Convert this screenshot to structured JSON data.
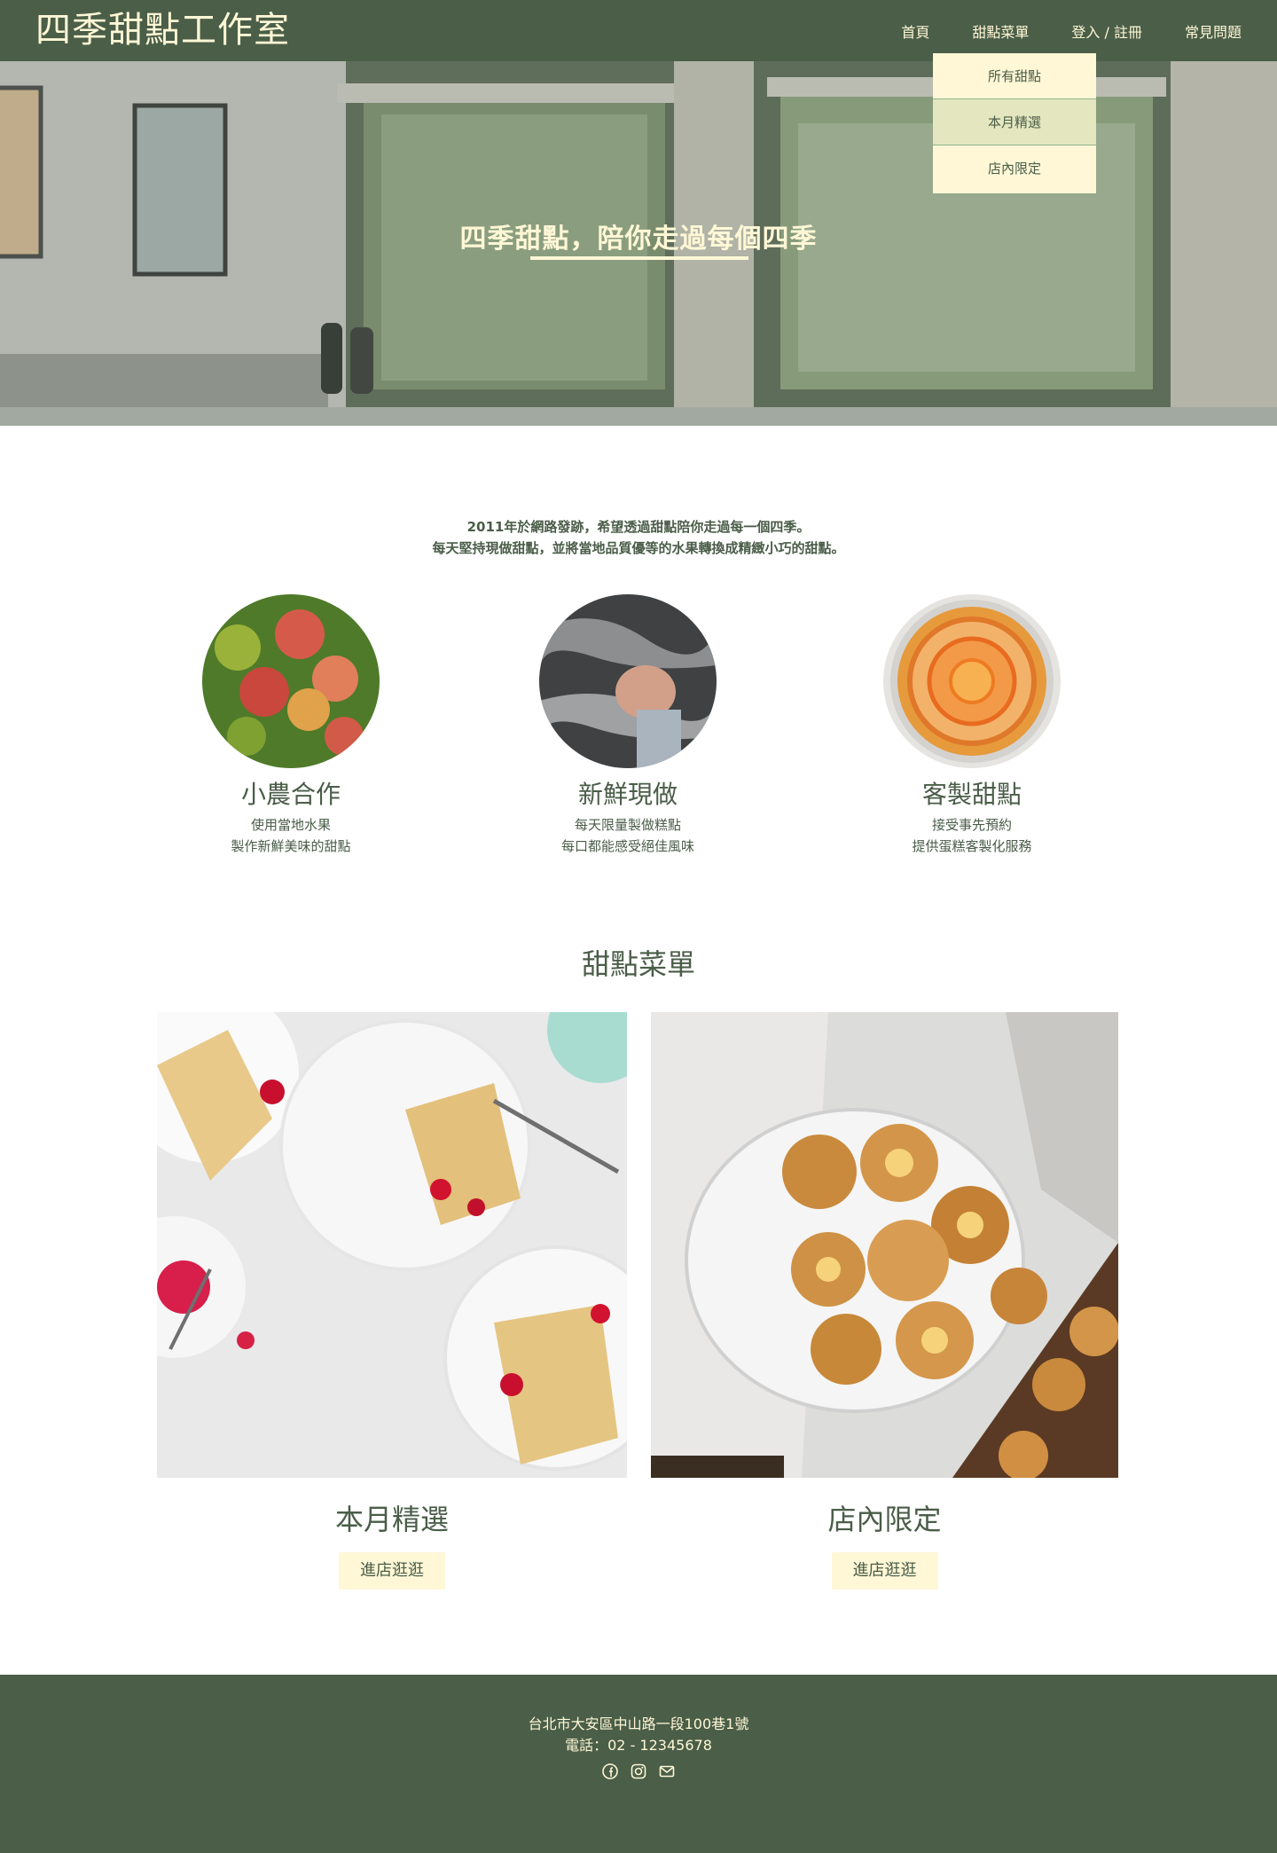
{
  "nav": {
    "brand": "四季甜點工作室",
    "items": [
      {
        "label": "首頁"
      },
      {
        "label": "甜點菜單"
      },
      {
        "label": "登入 / 註冊"
      },
      {
        "label": "常見問題"
      }
    ],
    "dropdown": [
      {
        "label": "所有甜點"
      },
      {
        "label": "本月精選",
        "active": true
      },
      {
        "label": "店內限定"
      }
    ]
  },
  "hero": {
    "title": "四季甜點，陪你走過每個四季"
  },
  "intro": {
    "line1": "2011年於網路發跡，希望透過甜點陪你走過每一個四季。",
    "line2": "每天堅持現做甜點，並將當地品質優等的水果轉換成精緻小巧的甜點。"
  },
  "features": [
    {
      "title": "小農合作",
      "desc1": "使用當地水果",
      "desc2": "製作新鮮美味的甜點"
    },
    {
      "title": "新鮮現做",
      "desc1": "每天限量製做糕點",
      "desc2": "每口都能感受絕佳風味"
    },
    {
      "title": "客製甜點",
      "desc1": "接受事先預約",
      "desc2": "提供蛋糕客製化服務"
    }
  ],
  "menu_section": {
    "title": "甜點菜單",
    "cards": [
      {
        "title": "本月精選",
        "button": "進店逛逛"
      },
      {
        "title": "店內限定",
        "button": "進店逛逛"
      }
    ]
  },
  "footer": {
    "address": "台北市大安區中山路一段100巷1號",
    "phone": "電話：02 - 12345678",
    "icons": [
      "facebook-icon",
      "instagram-icon",
      "mail-icon"
    ]
  },
  "colors": {
    "primary": "#4a5e48",
    "accent": "#fff7d6",
    "dropdown_active": "#e4e6c0"
  }
}
